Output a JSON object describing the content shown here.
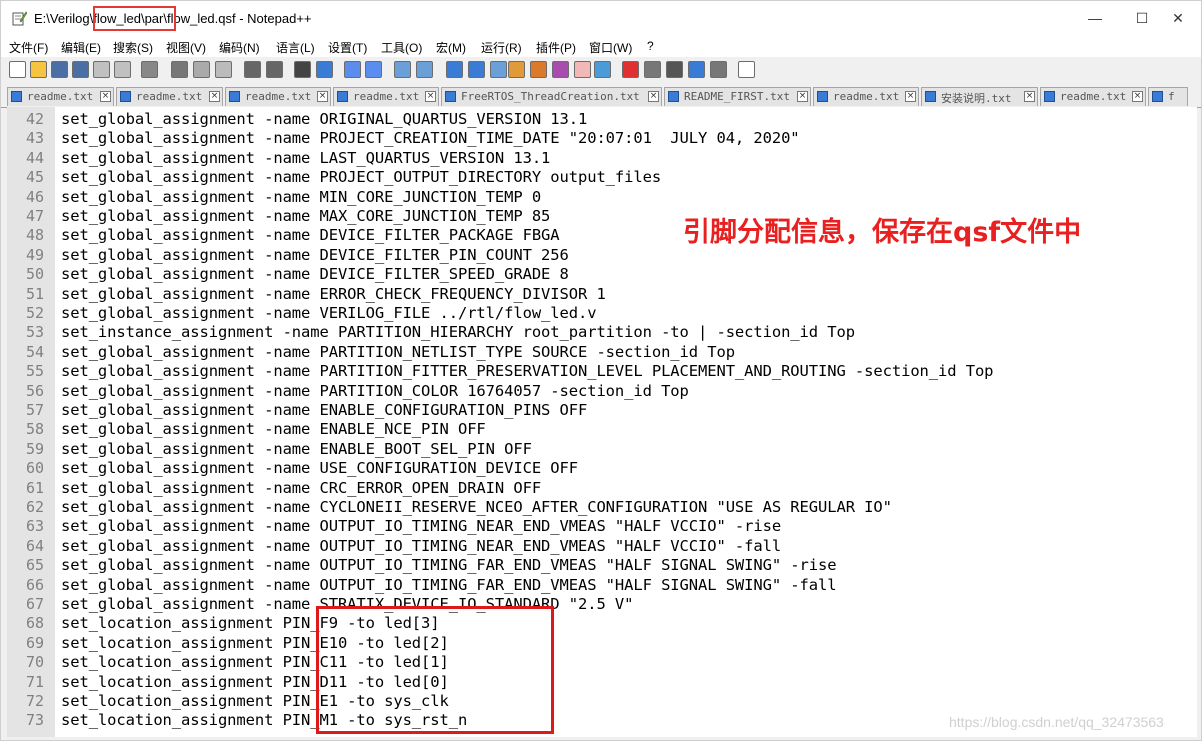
{
  "window": {
    "title": "E:\\Verilog\\flow_led\\par\\flow_led.qsf - Notepad++",
    "minimize": "—",
    "maximize": "☐",
    "close": "✕"
  },
  "menu": [
    "文件(F)",
    "编辑(E)",
    "搜索(S)",
    "视图(V)",
    "编码(N)",
    "语言(L)",
    "设置(T)",
    "工具(O)",
    "宏(M)",
    "运行(R)",
    "插件(P)",
    "窗口(W)",
    "?"
  ],
  "toolbar_icons": [
    "new-file-icon",
    "open-file-icon",
    "save-icon",
    "save-all-icon",
    "close-icon",
    "close-all-icon",
    "print-icon",
    "cut-icon",
    "copy-icon",
    "paste-icon",
    "undo-icon",
    "redo-icon",
    "find-icon",
    "replace-icon",
    "zoom-in-icon",
    "zoom-out-icon",
    "sync-v-icon",
    "sync-h-icon",
    "wrap-icon",
    "all-chars-icon",
    "indent-guide-icon",
    "udl-icon",
    "doc-map-icon",
    "function-list-icon",
    "folder-workspace-icon",
    "monitor-icon",
    "record-macro-icon",
    "stop-macro-icon",
    "play-macro-icon",
    "run-macro-icon",
    "save-macro-icon",
    "spellcheck-icon"
  ],
  "tabs": [
    {
      "label": "readme.txt"
    },
    {
      "label": "readme.txt"
    },
    {
      "label": "readme.txt"
    },
    {
      "label": "readme.txt"
    },
    {
      "label": "FreeRTOS_ThreadCreation.txt"
    },
    {
      "label": "README_FIRST.txt"
    },
    {
      "label": "readme.txt"
    },
    {
      "label": "安装说明.txt"
    },
    {
      "label": "readme.txt"
    },
    {
      "label": "f"
    }
  ],
  "lines": [
    {
      "n": "42",
      "code": "set_global_assignment -name ORIGINAL_QUARTUS_VERSION 13.1"
    },
    {
      "n": "43",
      "code": "set_global_assignment -name PROJECT_CREATION_TIME_DATE \"20:07:01  JULY 04, 2020\""
    },
    {
      "n": "44",
      "code": "set_global_assignment -name LAST_QUARTUS_VERSION 13.1"
    },
    {
      "n": "45",
      "code": "set_global_assignment -name PROJECT_OUTPUT_DIRECTORY output_files"
    },
    {
      "n": "46",
      "code": "set_global_assignment -name MIN_CORE_JUNCTION_TEMP 0"
    },
    {
      "n": "47",
      "code": "set_global_assignment -name MAX_CORE_JUNCTION_TEMP 85"
    },
    {
      "n": "48",
      "code": "set_global_assignment -name DEVICE_FILTER_PACKAGE FBGA"
    },
    {
      "n": "49",
      "code": "set_global_assignment -name DEVICE_FILTER_PIN_COUNT 256"
    },
    {
      "n": "50",
      "code": "set_global_assignment -name DEVICE_FILTER_SPEED_GRADE 8"
    },
    {
      "n": "51",
      "code": "set_global_assignment -name ERROR_CHECK_FREQUENCY_DIVISOR 1"
    },
    {
      "n": "52",
      "code": "set_global_assignment -name VERILOG_FILE ../rtl/flow_led.v"
    },
    {
      "n": "53",
      "code": "set_instance_assignment -name PARTITION_HIERARCHY root_partition -to | -section_id Top"
    },
    {
      "n": "54",
      "code": "set_global_assignment -name PARTITION_NETLIST_TYPE SOURCE -section_id Top"
    },
    {
      "n": "55",
      "code": "set_global_assignment -name PARTITION_FITTER_PRESERVATION_LEVEL PLACEMENT_AND_ROUTING -section_id Top"
    },
    {
      "n": "56",
      "code": "set_global_assignment -name PARTITION_COLOR 16764057 -section_id Top"
    },
    {
      "n": "57",
      "code": "set_global_assignment -name ENABLE_CONFIGURATION_PINS OFF"
    },
    {
      "n": "58",
      "code": "set_global_assignment -name ENABLE_NCE_PIN OFF"
    },
    {
      "n": "59",
      "code": "set_global_assignment -name ENABLE_BOOT_SEL_PIN OFF"
    },
    {
      "n": "60",
      "code": "set_global_assignment -name USE_CONFIGURATION_DEVICE OFF"
    },
    {
      "n": "61",
      "code": "set_global_assignment -name CRC_ERROR_OPEN_DRAIN OFF"
    },
    {
      "n": "62",
      "code": "set_global_assignment -name CYCLONEII_RESERVE_NCEO_AFTER_CONFIGURATION \"USE AS REGULAR IO\""
    },
    {
      "n": "63",
      "code": "set_global_assignment -name OUTPUT_IO_TIMING_NEAR_END_VMEAS \"HALF VCCIO\" -rise"
    },
    {
      "n": "64",
      "code": "set_global_assignment -name OUTPUT_IO_TIMING_NEAR_END_VMEAS \"HALF VCCIO\" -fall"
    },
    {
      "n": "65",
      "code": "set_global_assignment -name OUTPUT_IO_TIMING_FAR_END_VMEAS \"HALF SIGNAL SWING\" -rise"
    },
    {
      "n": "66",
      "code": "set_global_assignment -name OUTPUT_IO_TIMING_FAR_END_VMEAS \"HALF SIGNAL SWING\" -fall"
    },
    {
      "n": "67",
      "code": "set_global_assignment -name STRATIX_DEVICE_IO_STANDARD \"2.5 V\""
    },
    {
      "n": "68",
      "code": "set_location_assignment PIN_F9 -to led[3]"
    },
    {
      "n": "69",
      "code": "set_location_assignment PIN_E10 -to led[2]"
    },
    {
      "n": "70",
      "code": "set_location_assignment PIN_C11 -to led[1]"
    },
    {
      "n": "71",
      "code": "set_location_assignment PIN_D11 -to led[0]"
    },
    {
      "n": "72",
      "code": "set_location_assignment PIN_E1 -to sys_clk"
    },
    {
      "n": "73",
      "code": "set_location_assignment PIN_M1 -to sys_rst_n"
    }
  ],
  "annotation": "引脚分配信息，保存在qsf文件中",
  "watermark": "https://blog.csdn.net/qq_32473563",
  "colors": {
    "annotation": "#e82020",
    "highlight_box": "#e01818",
    "line_number": "#808080",
    "gutter": "#e4e4e4"
  }
}
